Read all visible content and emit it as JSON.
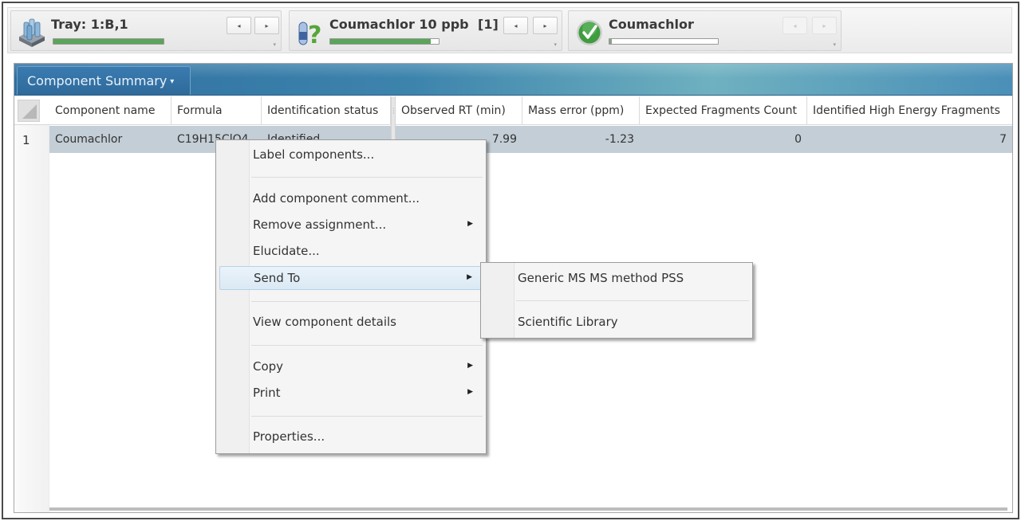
{
  "status_bar": {
    "tiles": [
      {
        "icon": "tray-vials-icon",
        "title": "Tray: 1:B,1",
        "progress": 1.0,
        "prev_label": "◂",
        "next_label": "▸",
        "nav_enabled": true
      },
      {
        "icon": "sample-unknown-icon",
        "title": "Coumachlor 10 ppb",
        "count": "[1]",
        "progress": 0.93,
        "prev_label": "◂",
        "next_label": "▸",
        "nav_enabled": true
      },
      {
        "icon": "check-identified-icon",
        "title": "Coumachlor",
        "progress": 0.02,
        "prev_label": "◂",
        "next_label": "▸",
        "nav_enabled": false
      }
    ],
    "dropdown_caret": "▾"
  },
  "panel": {
    "title": "Component Summary",
    "title_caret": "▾",
    "columns": [
      "Component name",
      "Formula",
      "Identification status",
      "Observed RT (min)",
      "Mass error (ppm)",
      "Expected Fragments Count",
      "Identified High Energy Fragments"
    ],
    "rows": [
      {
        "index": "1",
        "component_name": "Coumachlor",
        "formula": "C19H15ClO4",
        "identification_status": "Identified",
        "observed_rt": "7.99",
        "mass_error": "-1.23",
        "expected_fragments": "0",
        "identified_he_fragments": "7"
      }
    ]
  },
  "context_menu": {
    "items": [
      {
        "label": "Label components...",
        "submenu": false
      },
      {
        "label": "Add component comment...",
        "submenu": false
      },
      {
        "label": "Remove assignment...",
        "submenu": true
      },
      {
        "label": "Elucidate...",
        "submenu": false
      },
      {
        "label": "Send To",
        "submenu": true,
        "highlighted": true
      },
      {
        "label": "View component details",
        "submenu": false
      },
      {
        "label": "Copy",
        "submenu": true
      },
      {
        "label": "Print",
        "submenu": true
      },
      {
        "label": "Properties...",
        "submenu": false
      }
    ],
    "submenu_arrow": "▶"
  },
  "send_to_submenu": {
    "items": [
      {
        "label": "Generic MS MS method PSS"
      },
      {
        "label": "Scientific Library"
      }
    ]
  }
}
